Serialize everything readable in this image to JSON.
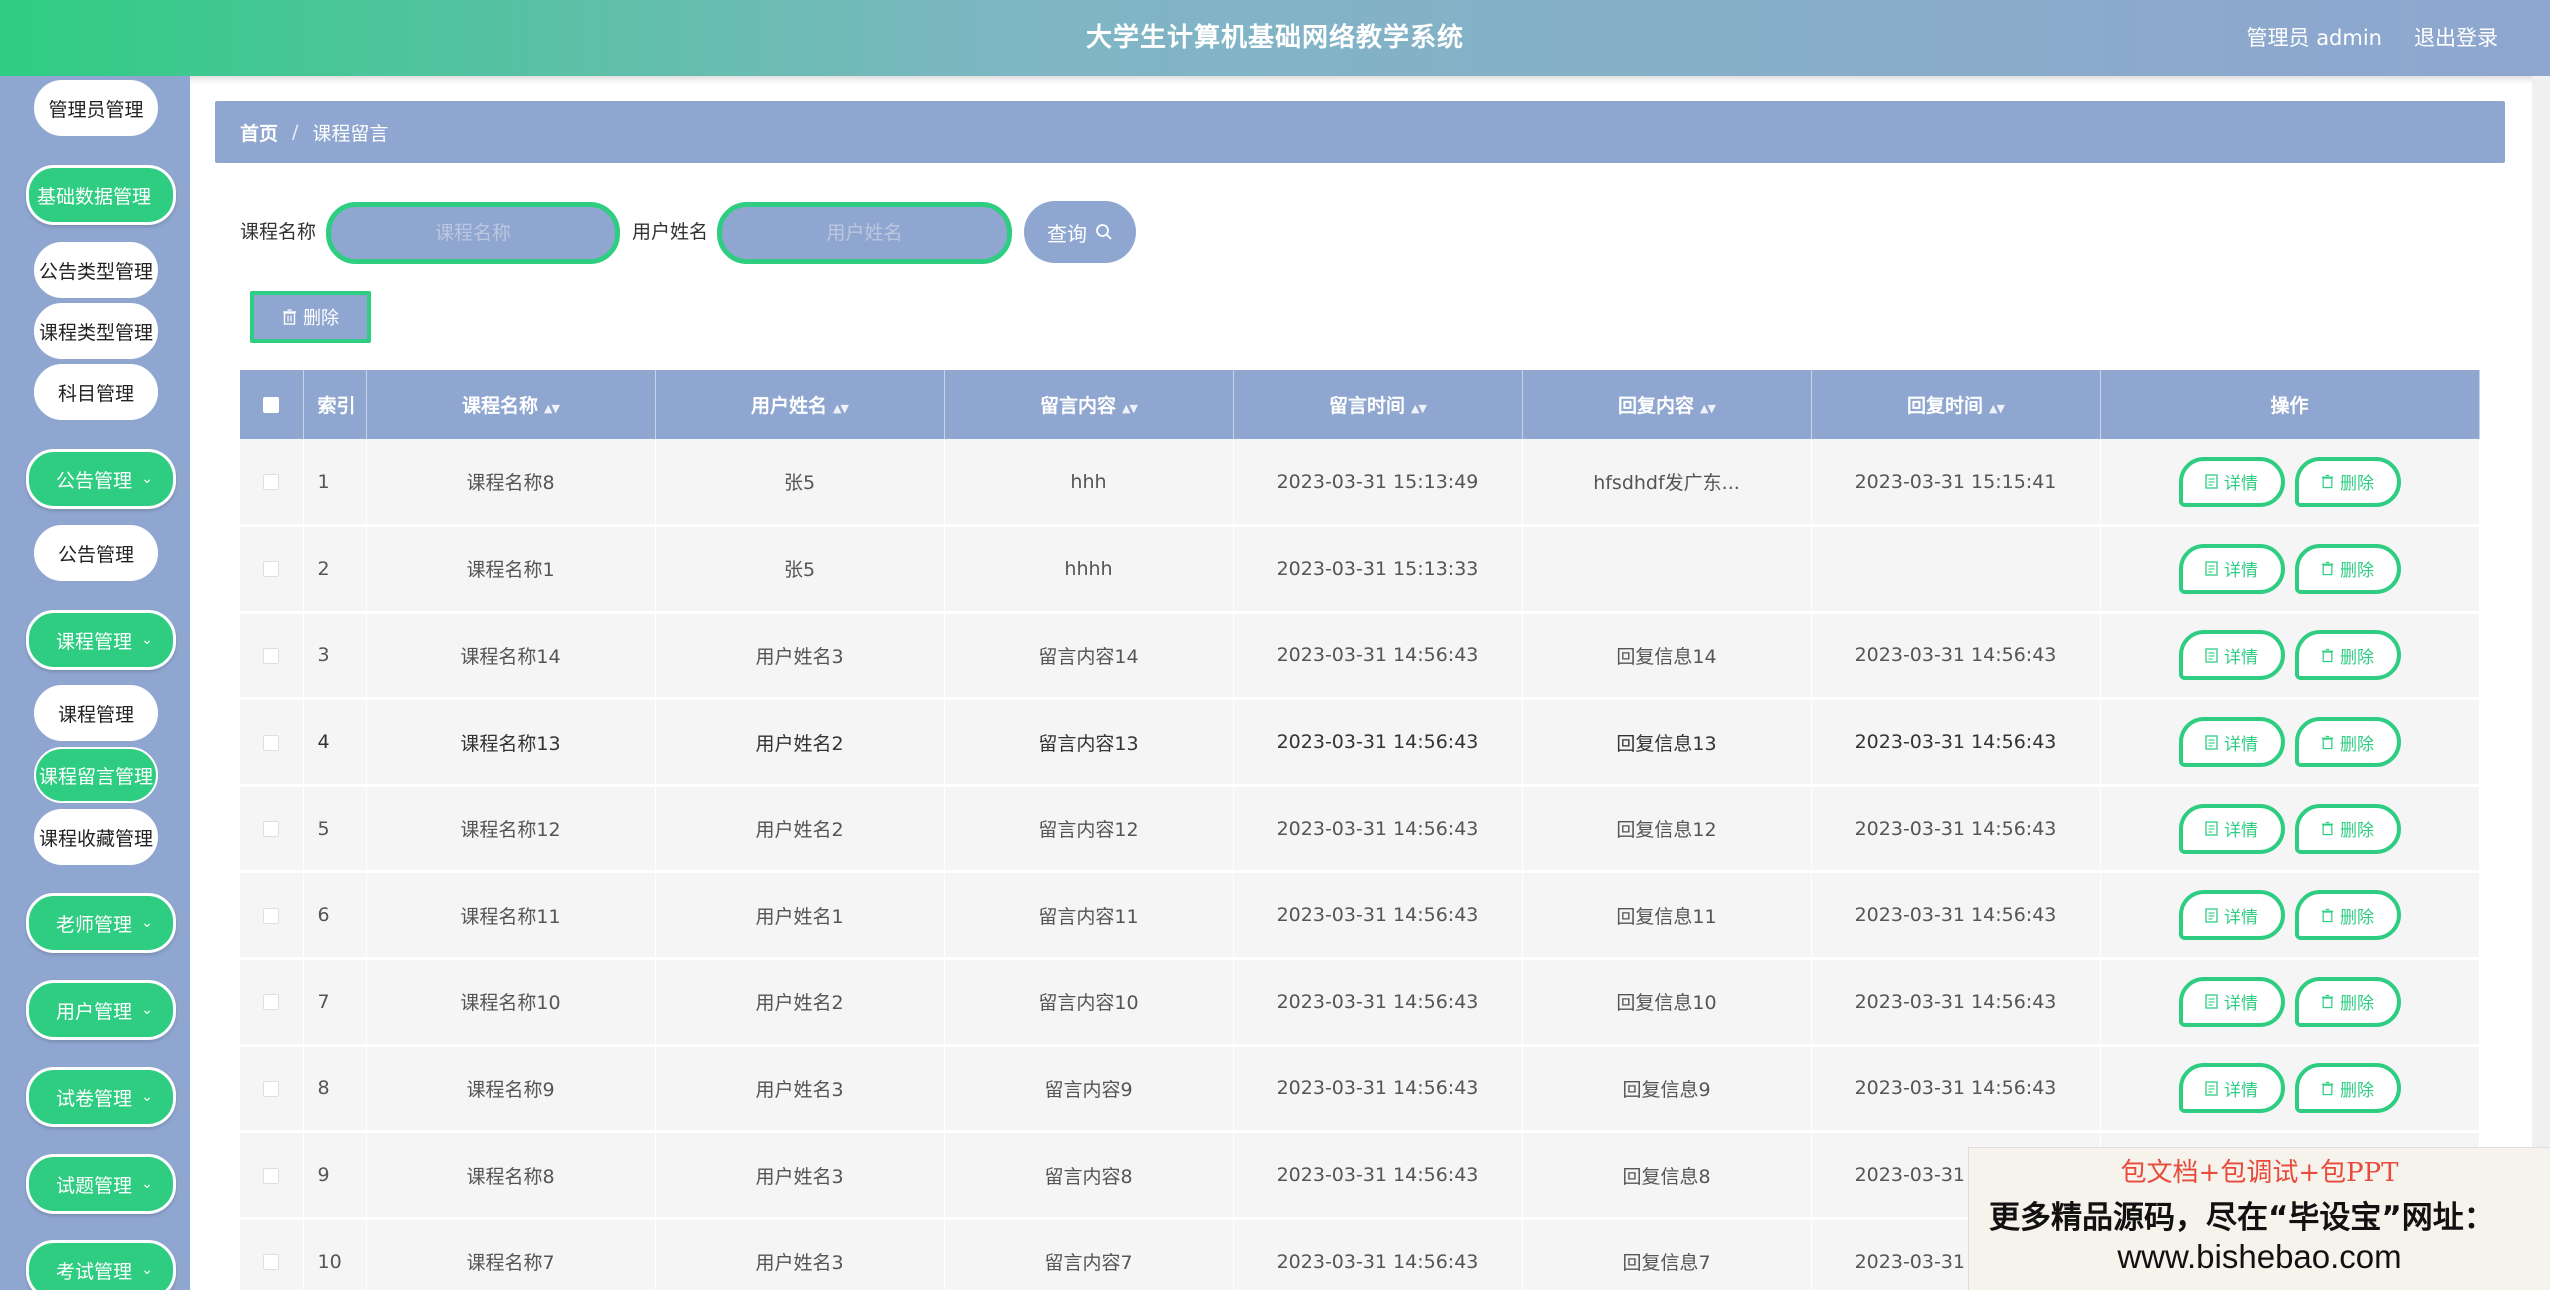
{
  "header": {
    "title": "大学生计算机基础网络教学系统",
    "user": "管理员 admin",
    "logout": "退出登录"
  },
  "sidebar": {
    "items": [
      {
        "label": "管理员管理",
        "type": "sub"
      },
      {
        "label": "基础数据管理",
        "type": "top",
        "chevron": "⌄"
      },
      {
        "label": "公告类型管理",
        "type": "sub"
      },
      {
        "label": "课程类型管理",
        "type": "sub"
      },
      {
        "label": "科目管理",
        "type": "sub"
      },
      {
        "label": "公告管理",
        "type": "top",
        "chevron": "⌄"
      },
      {
        "label": "公告管理",
        "type": "sub"
      },
      {
        "label": "课程管理",
        "type": "top",
        "chevron": "⌄"
      },
      {
        "label": "课程管理",
        "type": "sub"
      },
      {
        "label": "课程留言管理",
        "type": "sub",
        "active": true
      },
      {
        "label": "课程收藏管理",
        "type": "sub"
      },
      {
        "label": "老师管理",
        "type": "top",
        "chevron": "⌄"
      },
      {
        "label": "用户管理",
        "type": "top",
        "chevron": "⌄"
      },
      {
        "label": "试卷管理",
        "type": "top",
        "chevron": "⌄"
      },
      {
        "label": "试题管理",
        "type": "top",
        "chevron": "⌄"
      },
      {
        "label": "考试管理",
        "type": "top",
        "chevron": "⌄"
      }
    ]
  },
  "breadcrumb": {
    "home": "首页",
    "separator": "/",
    "current": "课程留言"
  },
  "search": {
    "course_label": "课程名称",
    "course_placeholder": "课程名称",
    "user_label": "用户姓名",
    "user_placeholder": "用户姓名",
    "query_label": "查询"
  },
  "toolbar": {
    "delete_label": "删除"
  },
  "table": {
    "headers": [
      "索引",
      "课程名称",
      "用户姓名",
      "留言内容",
      "留言时间",
      "回复内容",
      "回复时间",
      "操作"
    ],
    "detail_label": "详情",
    "delete_label": "删除",
    "rows": [
      [
        "1",
        "课程名称8",
        "张5",
        "hhh",
        "2023-03-31 15:13:49",
        "hfsdhdf发广东...",
        "2023-03-31 15:15:41"
      ],
      [
        "2",
        "课程名称1",
        "张5",
        "hhhh",
        "2023-03-31 15:13:33",
        "",
        ""
      ],
      [
        "3",
        "课程名称14",
        "用户姓名3",
        "留言内容14",
        "2023-03-31 14:56:43",
        "回复信息14",
        "2023-03-31 14:56:43"
      ],
      [
        "4",
        "课程名称13",
        "用户姓名2",
        "留言内容13",
        "2023-03-31 14:56:43",
        "回复信息13",
        "2023-03-31 14:56:43"
      ],
      [
        "5",
        "课程名称12",
        "用户姓名2",
        "留言内容12",
        "2023-03-31 14:56:43",
        "回复信息12",
        "2023-03-31 14:56:43"
      ],
      [
        "6",
        "课程名称11",
        "用户姓名1",
        "留言内容11",
        "2023-03-31 14:56:43",
        "回复信息11",
        "2023-03-31 14:56:43"
      ],
      [
        "7",
        "课程名称10",
        "用户姓名2",
        "留言内容10",
        "2023-03-31 14:56:43",
        "回复信息10",
        "2023-03-31 14:56:43"
      ],
      [
        "8",
        "课程名称9",
        "用户姓名3",
        "留言内容9",
        "2023-03-31 14:56:43",
        "回复信息9",
        "2023-03-31 14:56:43"
      ],
      [
        "9",
        "课程名称8",
        "用户姓名3",
        "留言内容8",
        "2023-03-31 14:56:43",
        "回复信息8",
        "2023-03-31 14:56:43"
      ],
      [
        "10",
        "课程名称7",
        "用户姓名3",
        "留言内容7",
        "2023-03-31 14:56:43",
        "回复信息7",
        "2023-03-31 14:56:43"
      ]
    ]
  },
  "ad": {
    "line1": "包文档+包调试+包PPT",
    "line2": "更多精品源码，尽在“毕设宝”网址：",
    "line3": "www.bishebao.com"
  },
  "colors": {
    "accent": "#2fcd82",
    "nav": "#8fa6d0"
  }
}
